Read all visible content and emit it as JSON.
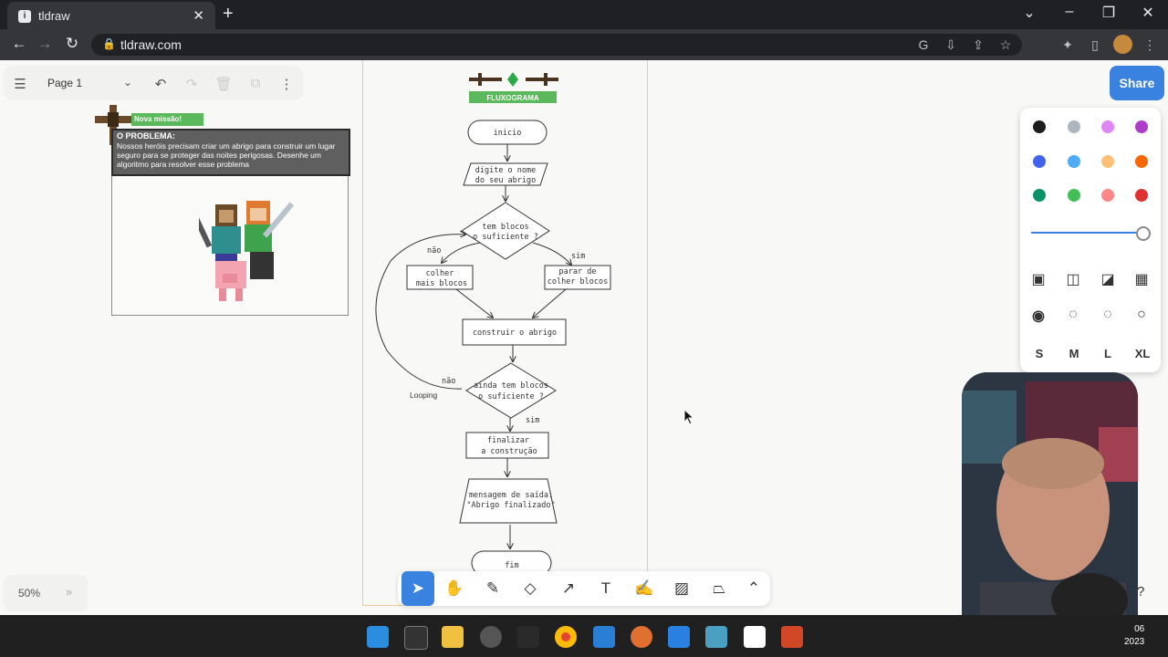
{
  "browser": {
    "tab_title": "tldraw",
    "tab_icon": "i",
    "url": "tldraw.com"
  },
  "tldraw": {
    "page_name": "Page 1",
    "share_label": "Share",
    "zoom": "50%",
    "sizes": [
      "S",
      "M",
      "L",
      "XL"
    ],
    "colors": [
      "#1d1d1d",
      "#adb5bd",
      "#e085f4",
      "#ae3ec9",
      "#4263eb",
      "#4dabf7",
      "#ffc078",
      "#f76707",
      "#099268",
      "#40c057",
      "#ff8787",
      "#e03131"
    ],
    "help": "?"
  },
  "mission": {
    "badge": "Nova missão!",
    "title": "O PROBLEMA:",
    "text": "Nossos heróis precisam criar um abrigo para construir um lugar seguro para se proteger das noites perigosas. Desenhe um algoritmo para resolver esse problema"
  },
  "flowchart": {
    "header": "FLUXOGRAMA",
    "start": "inicio",
    "input_line1": "digite o nome",
    "input_line2": "do seu abrigo",
    "decision1_line1": "tem blocos",
    "decision1_line2": "o suficiente ?",
    "no1": "não",
    "yes1": "sim",
    "gather_line1": "colher",
    "gather_line2": "mais blocos",
    "stop_line1": "parar de",
    "stop_line2": "colher blocos",
    "build": "construir o abrigo",
    "decision2_line1": "ainda tem blocos",
    "decision2_line2": "o suficiente ?",
    "no2": "não",
    "yes2": "sim",
    "loop_label": "Looping",
    "finish_line1": "finalizar",
    "finish_line2": "a construção",
    "output_line1": "mensagem de saída:",
    "output_line2": "\"Abrigo finalizado\"",
    "end": "fim"
  },
  "taskbar": {
    "time": "06",
    "date": "2023"
  }
}
